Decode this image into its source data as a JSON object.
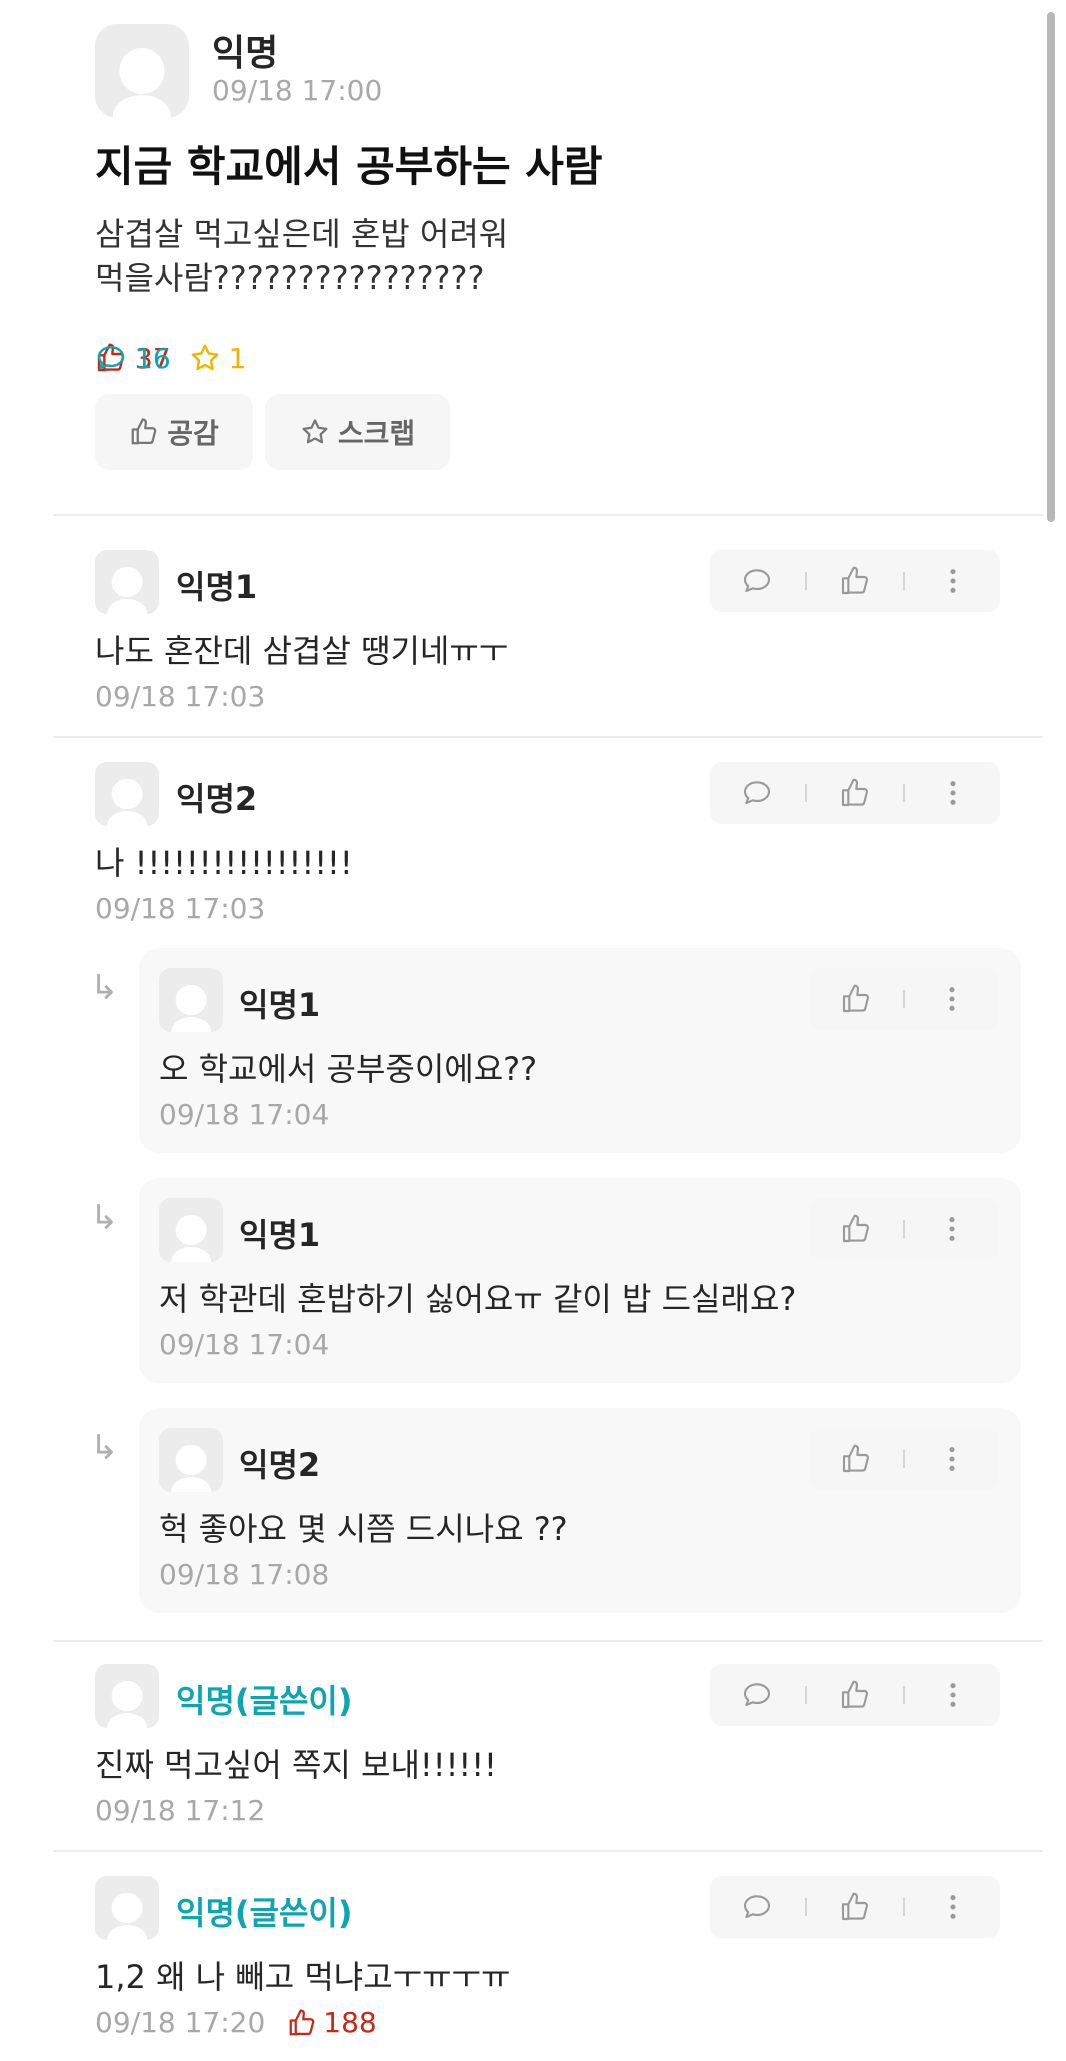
{
  "post": {
    "author": "익명",
    "time": "09/18 17:00",
    "title": "지금 학교에서 공부하는 사람",
    "body_line1": "삼겹살 먹고싶은데 혼밥 어려워",
    "body_line2": "먹을사람????????????????",
    "likes": "37",
    "comments": "16",
    "scraps": "1",
    "like_button": "공감",
    "scrap_button": "스크랩"
  },
  "comments": [
    {
      "author": "익명1",
      "text": "나도 혼잔데 삼겹살 땡기네ㅠㅜ",
      "time": "09/18 17:03"
    },
    {
      "author": "익명2",
      "text": "나 !!!!!!!!!!!!!!!!!",
      "time": "09/18 17:03",
      "replies": [
        {
          "author": "익명1",
          "text": "오 학교에서 공부중이에요??",
          "time": "09/18 17:04"
        },
        {
          "author": "익명1",
          "text": "저 학관데 혼밥하기 싫어요ㅠ 같이 밥 드실래요?",
          "time": "09/18 17:04"
        },
        {
          "author": "익명2",
          "text": "헉 좋아요 몇 시쯤 드시나요 ??",
          "time": "09/18 17:08"
        }
      ]
    },
    {
      "author": "익명(글쓴이)",
      "text": "진짜 먹고싶어 쪽지 보내!!!!!!",
      "time": "09/18 17:12"
    },
    {
      "author": "익명(글쓴이)",
      "text": "1,2 왜 나 빼고 먹냐고ㅜㅠㅜㅠ",
      "time": "09/18 17:20",
      "likes": "188"
    }
  ],
  "icons": {
    "like": "thumbs-up-icon",
    "comment": "speech-bubble-icon",
    "scrap": "star-icon",
    "more": "more-vertical-icon",
    "reply": "reply-arrow-icon"
  },
  "colors": {
    "like": "#c62917",
    "comment": "#0ca5b0",
    "scrap": "#f0b400",
    "op_author": "#0ca5b0",
    "muted": "#a8a8a8"
  }
}
